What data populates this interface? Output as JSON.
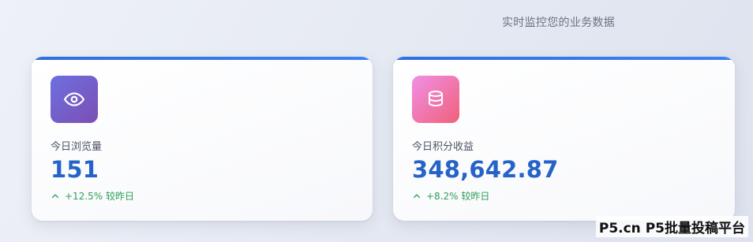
{
  "header": {
    "subtitle": "实时监控您的业务数据"
  },
  "cards": [
    {
      "icon": "eye-icon",
      "label": "今日浏览量",
      "value": "151",
      "trend": "+12.5% 较昨日",
      "accent": "#2563c9"
    },
    {
      "icon": "coins-icon",
      "label": "今日积分收益",
      "value": "348,642.87",
      "trend": "+8.2% 较昨日",
      "accent": "#2563c9"
    }
  ],
  "watermark": "P5.cn P5批量投稿平台",
  "colors": {
    "top_bar": "#3b82f6",
    "trend_up": "#2f9e5a",
    "value": "#2563c9"
  }
}
